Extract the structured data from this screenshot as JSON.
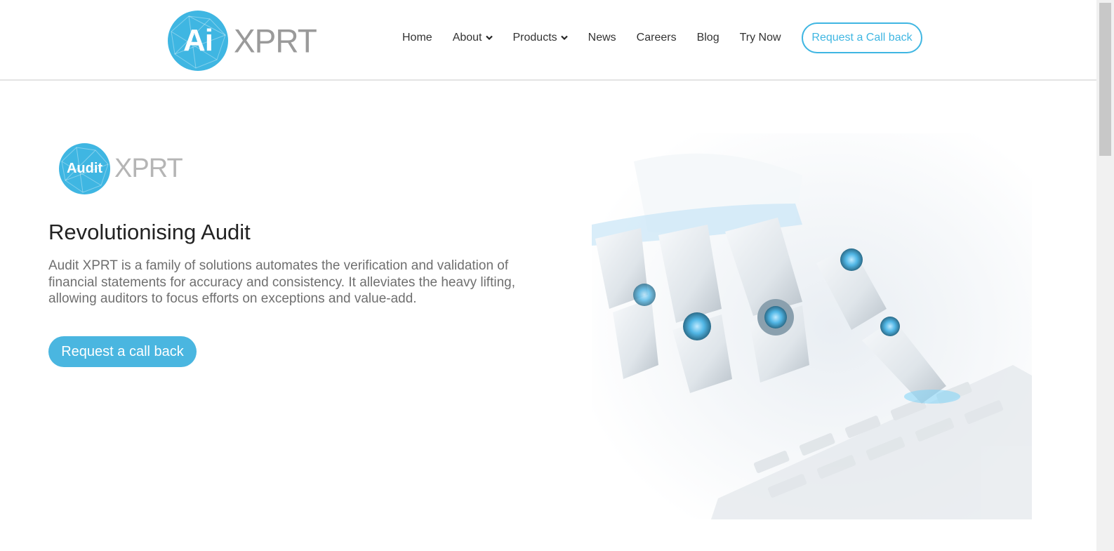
{
  "brand": {
    "mark": "Ai",
    "word": "XPRT",
    "color": "#3fb6e2"
  },
  "nav": {
    "items": [
      {
        "label": "Home",
        "dropdown": false
      },
      {
        "label": "About",
        "dropdown": true
      },
      {
        "label": "Products",
        "dropdown": true
      },
      {
        "label": "News",
        "dropdown": false
      },
      {
        "label": "Careers",
        "dropdown": false
      },
      {
        "label": "Blog",
        "dropdown": false
      },
      {
        "label": "Try Now",
        "dropdown": false
      }
    ],
    "cta_label": "Request a Call back"
  },
  "hero": {
    "product_logo": {
      "mark": "Audit",
      "word": "XPRT"
    },
    "headline": "Revolutionising Audit",
    "description": "Audit XPRT is a family of solutions automates the verification and validation of financial statements for accuracy and consistency. It alleviates the heavy lifting, allowing auditors to focus efforts on exceptions and value-add.",
    "cta_label": "Request a call back",
    "image": "robot-hand-typing-on-laptop"
  },
  "colors": {
    "accent": "#3fb6e2",
    "text": "#222222",
    "muted": "#6f6f6f"
  }
}
